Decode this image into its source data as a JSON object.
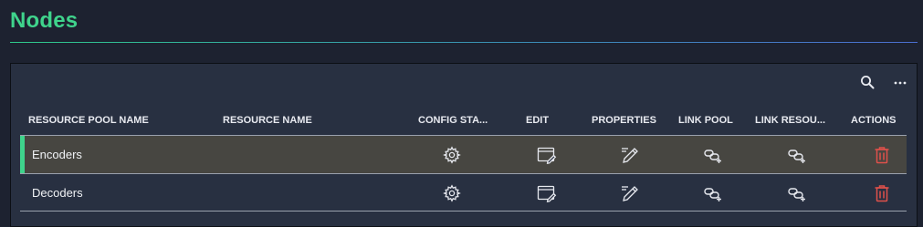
{
  "page": {
    "title": "Nodes"
  },
  "colors": {
    "accent": "#3fd48c",
    "panel": "#283041",
    "background": "#1d2230",
    "selected_row": "#474641",
    "delete": "#e0514b"
  },
  "toolbar": {
    "search_icon": "search-icon",
    "more_icon": "more-horizontal-icon"
  },
  "table": {
    "columns": [
      "RESOURCE POOL NAME",
      "RESOURCE NAME",
      "CONFIG STA...",
      "EDIT",
      "PROPERTIES",
      "LINK POOL",
      "LINK RESOU...",
      "ACTIONS"
    ],
    "rows": [
      {
        "resource_pool_name": "Encoders",
        "resource_name": "",
        "selected": true
      },
      {
        "resource_pool_name": "Decoders",
        "resource_name": "",
        "selected": false
      }
    ],
    "row_icons": [
      "gear-icon",
      "edit-window-icon",
      "pencil-icon",
      "link-icon",
      "link-icon",
      "trash-icon"
    ]
  }
}
